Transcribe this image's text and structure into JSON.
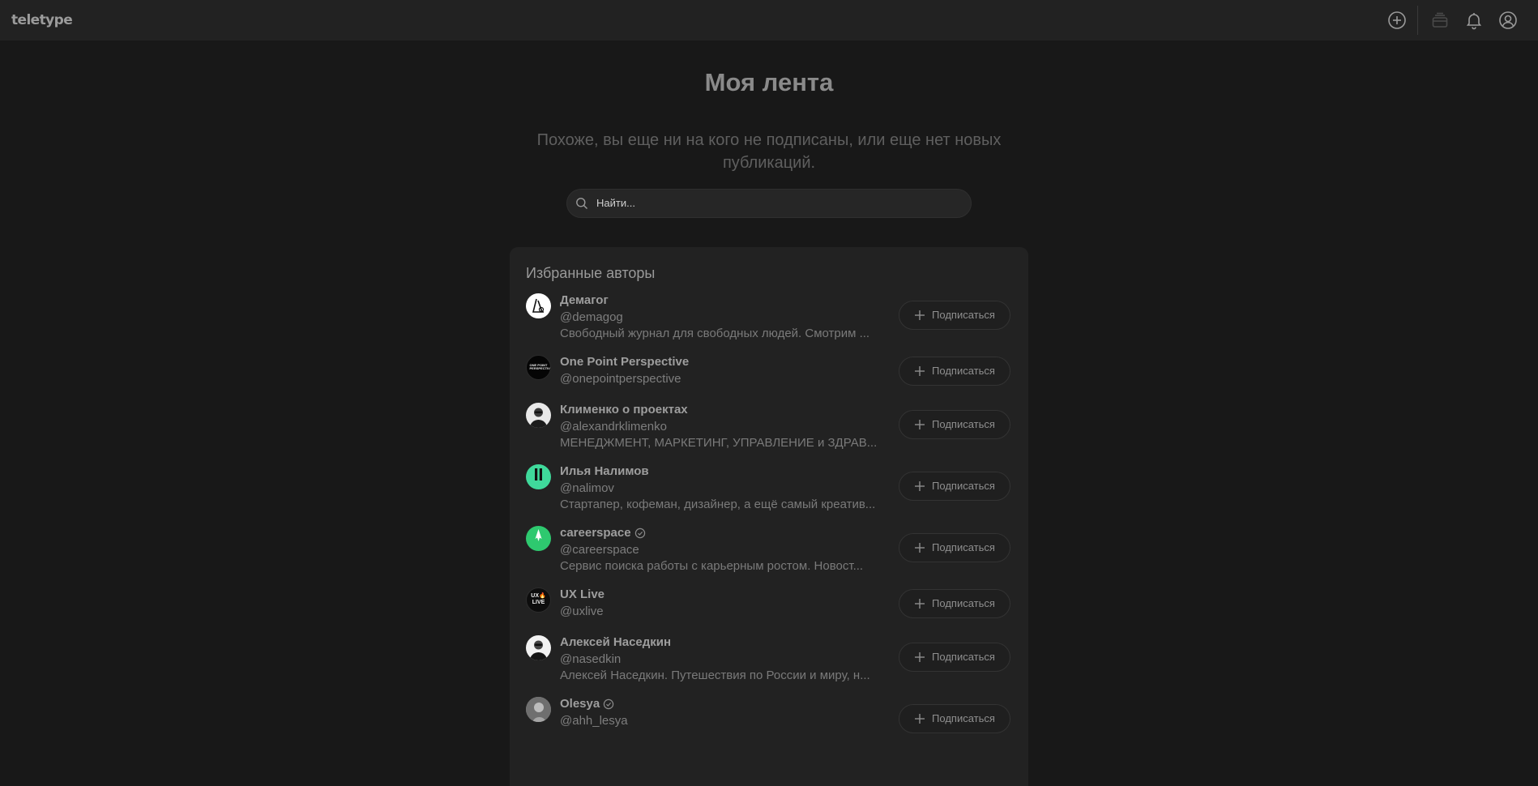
{
  "header": {
    "logo": "teletype",
    "icons": [
      "plus-circle-icon",
      "inbox-icon",
      "bell-icon",
      "user-icon"
    ]
  },
  "page": {
    "title": "Моя лента",
    "subtitle": "Похоже, вы еще ни на кого не подписаны, или еще нет новых публикаций.",
    "search_placeholder": "Найти..."
  },
  "featured": {
    "title": "Избранные авторы",
    "subscribe_label": "Подписаться",
    "authors": [
      {
        "name": "Демагог",
        "handle": "@demagog",
        "description": "Свободный журнал для свободных людей. Смотрим ...",
        "verified": false,
        "avatar": "demagog-logo"
      },
      {
        "name": "One Point Perspective",
        "handle": "@onepointperspective",
        "description": "",
        "verified": false,
        "avatar": "one-point-perspective-logo",
        "avatar_text": "ONE POINT PERSPECTIVE"
      },
      {
        "name": "Клименко о проектах",
        "handle": "@alexandrklimenko",
        "description": "МЕНЕДЖМЕНТ, МАРКЕТИНГ, УПРАВЛЕНИЕ и ЗДРАВ...",
        "verified": false,
        "avatar": "person-photo"
      },
      {
        "name": "Илья Налимов",
        "handle": "@nalimov",
        "description": "Стартапер, кофеман, дизайнер, а ещё самый креатив...",
        "verified": false,
        "avatar": "pause-logo"
      },
      {
        "name": "careerspace",
        "handle": "@careerspace",
        "description": "Сервис поиска работы с карьерным ростом. Новост...",
        "verified": true,
        "avatar": "rocket-logo"
      },
      {
        "name": "UX Live",
        "handle": "@uxlive",
        "description": "",
        "verified": false,
        "avatar": "ux-live-logo",
        "avatar_text_top": "UX🔥",
        "avatar_text_bottom": "LIVE"
      },
      {
        "name": "Алексей Наседкин",
        "handle": "@nasedkin",
        "description": "Алексей Наседкин. Путешествия по России и миру, н...",
        "verified": false,
        "avatar": "person-photo"
      },
      {
        "name": "Olesya",
        "handle": "@ahh_lesya",
        "description": "",
        "verified": true,
        "avatar": "person-photo"
      }
    ]
  },
  "colors": {
    "background": "#181818",
    "topbar": "#222222",
    "card": "#222222",
    "nalimov_avatar": "#3fd99b",
    "careerspace_avatar": "#2ec96f"
  }
}
